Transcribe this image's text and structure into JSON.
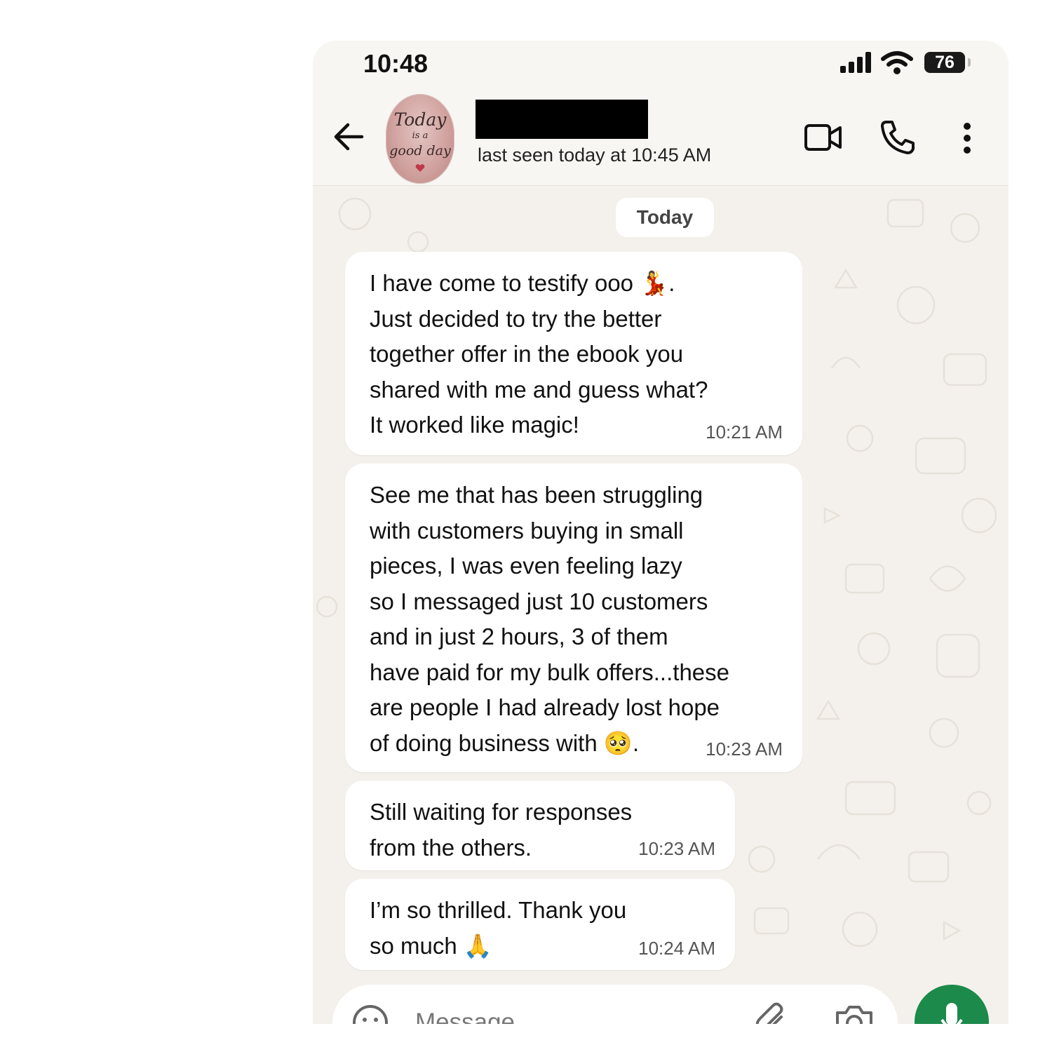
{
  "status_bar": {
    "time": "10:48",
    "battery": "76"
  },
  "header": {
    "avatar_text": [
      "Today",
      "is a",
      "good day"
    ],
    "contact_name": "",
    "last_seen": "last seen today at 10:45 AM",
    "icons": [
      "back-arrow-icon",
      "video-call-icon",
      "phone-icon",
      "more-vert-icon"
    ]
  },
  "chat": {
    "date_chip": "Today",
    "messages": [
      {
        "text": "I have come to testify ooo 💃.\nJust decided to try the better\ntogether offer in the ebook you\nshared with me and guess what?\nIt worked like magic!",
        "time": "10:21 AM"
      },
      {
        "text": "See me that has been struggling\nwith customers buying in small\npieces, I was even feeling lazy\nso I messaged just 10 customers\nand in just 2 hours, 3 of them\nhave paid for my bulk offers...these\nare people I had already lost hope\nof doing business with 🥺.",
        "time": "10:23 AM"
      },
      {
        "text": "Still waiting for responses\nfrom the others.",
        "time": "10:23 AM"
      },
      {
        "text": "I’m so thrilled. Thank you\nso much 🙏",
        "time": "10:24 AM"
      }
    ]
  },
  "composer": {
    "placeholder": "Message"
  },
  "colors": {
    "send_button": "#1b8a4a",
    "chat_background": "#f4f1ec",
    "bubble": "#ffffff"
  }
}
